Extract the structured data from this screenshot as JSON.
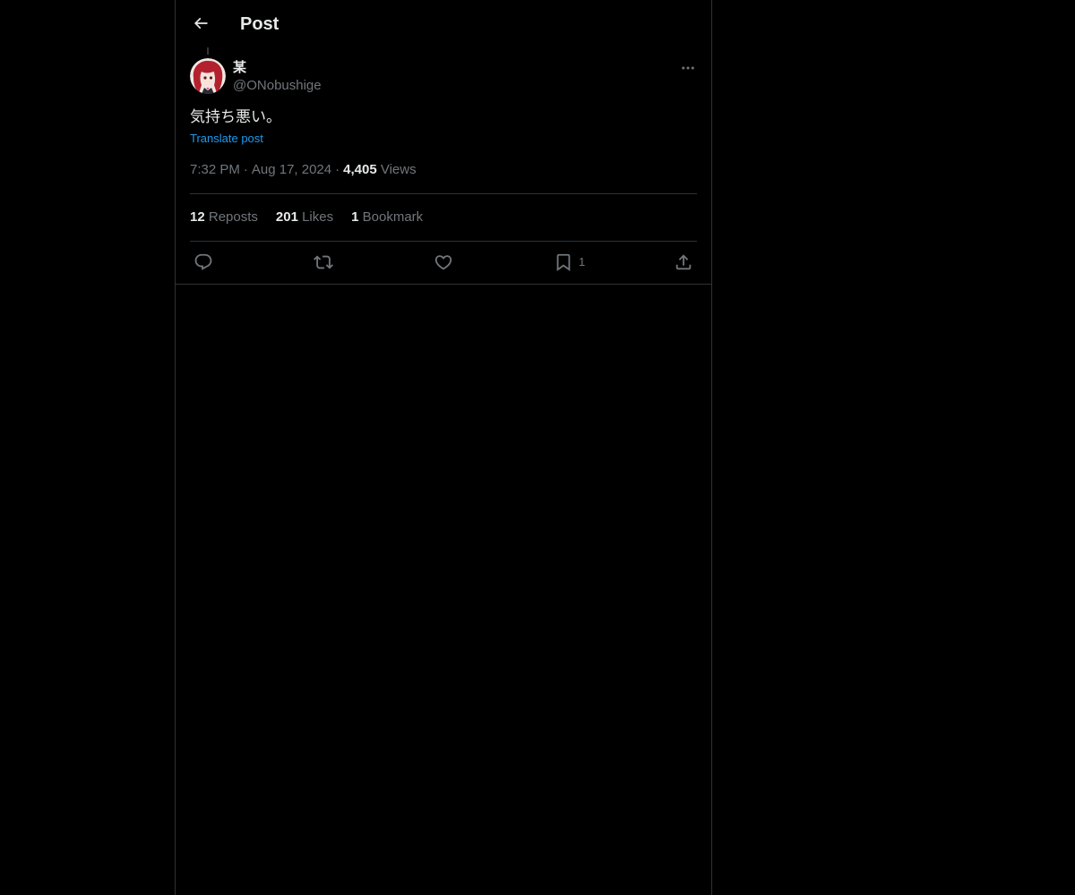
{
  "header": {
    "title": "Post",
    "back_icon": "arrow-left-icon"
  },
  "post": {
    "author": {
      "display_name": "某",
      "handle": "@ONobushige",
      "avatar": "avatar-image"
    },
    "text": "気持ち悪い。",
    "translate_label": "Translate post",
    "time": "7:32 PM",
    "separator": "·",
    "date": "Aug 17, 2024",
    "views_count": "4,405",
    "views_label": "Views"
  },
  "stats": {
    "reposts_count": "12",
    "reposts_label": "Reposts",
    "likes_count": "201",
    "likes_label": "Likes",
    "bookmarks_count": "1",
    "bookmarks_label": "Bookmark"
  },
  "actions": {
    "reply_icon": "reply-icon",
    "repost_icon": "repost-icon",
    "like_icon": "heart-icon",
    "bookmark_icon": "bookmark-icon",
    "bookmark_count": "1",
    "share_icon": "share-icon"
  },
  "colors": {
    "background": "#000000",
    "text_primary": "#e7e9ea",
    "text_secondary": "#71767b",
    "link": "#1d9bf0",
    "border": "#2f3336"
  }
}
